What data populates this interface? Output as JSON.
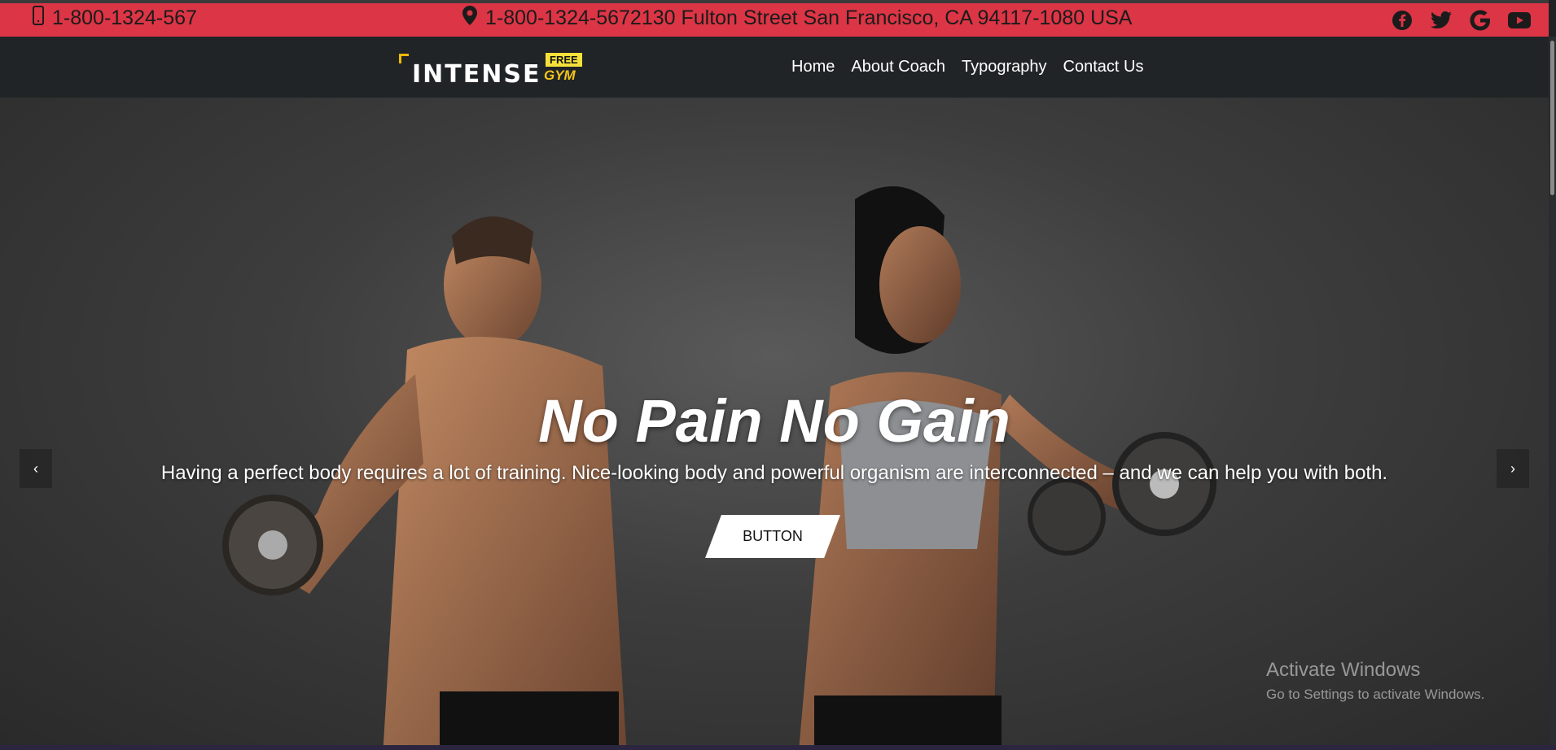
{
  "topbar": {
    "phone": "1-800-1324-567",
    "address": "1-800-1324-5672130 Fulton Street San Francisco, CA 94117-1080 USA",
    "social": [
      "facebook-icon",
      "twitter-icon",
      "google-icon",
      "youtube-icon"
    ],
    "bg_color": "#dc3545"
  },
  "brand": {
    "word": "INTENSE",
    "badge": "FREE",
    "sub": "GYM",
    "accent": "#f5c518"
  },
  "nav": {
    "items": [
      "Home",
      "About Coach",
      "Typography",
      "Contact Us"
    ]
  },
  "hero": {
    "title": "No Pain No Gain",
    "text": "Having a perfect body requires a lot of training. Nice-looking body and powerful organism are interconnected – and we can help you with both.",
    "button": "BUTTON",
    "prev": "‹",
    "next": "›"
  },
  "watermark": {
    "line1": "Activate Windows",
    "line2": "Go to Settings to activate Windows."
  }
}
